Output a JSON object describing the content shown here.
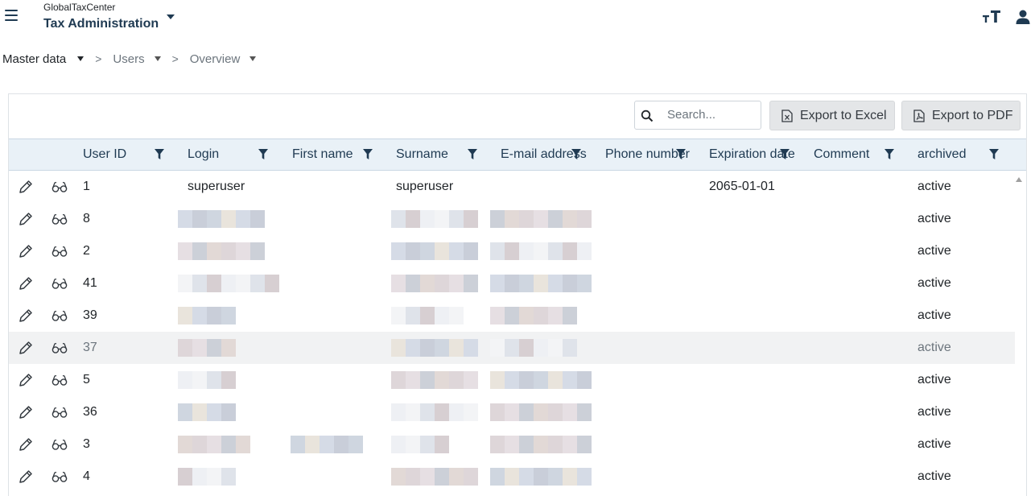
{
  "app": {
    "name": "GlobalTaxCenter",
    "module": "Tax Administration"
  },
  "breadcrumb": [
    "Master data",
    "Users",
    "Overview"
  ],
  "toolbar": {
    "search_placeholder": "Search...",
    "export_excel": "Export to Excel",
    "export_pdf": "Export to PDF"
  },
  "table": {
    "columns": [
      "User ID",
      "Login",
      "First name",
      "Surname",
      "E-mail address",
      "Phone number",
      "Expiration date",
      "Comment",
      "archived"
    ],
    "rows": [
      {
        "id": "1",
        "login": "superuser",
        "surname": "superuser",
        "expiration": "2065-01-01",
        "archived": "active"
      },
      {
        "id": "8",
        "archived": "active"
      },
      {
        "id": "2",
        "archived": "active"
      },
      {
        "id": "41",
        "archived": "active"
      },
      {
        "id": "39",
        "archived": "active"
      },
      {
        "id": "37",
        "archived": "active"
      },
      {
        "id": "5",
        "archived": "active"
      },
      {
        "id": "36",
        "archived": "active"
      },
      {
        "id": "3",
        "archived": "active"
      },
      {
        "id": "4",
        "archived": "active"
      }
    ]
  },
  "colors": {
    "header_bg": "#e9f1f7",
    "primary_text": "#1f3a52",
    "row_highlight": "#f1f2f3"
  }
}
